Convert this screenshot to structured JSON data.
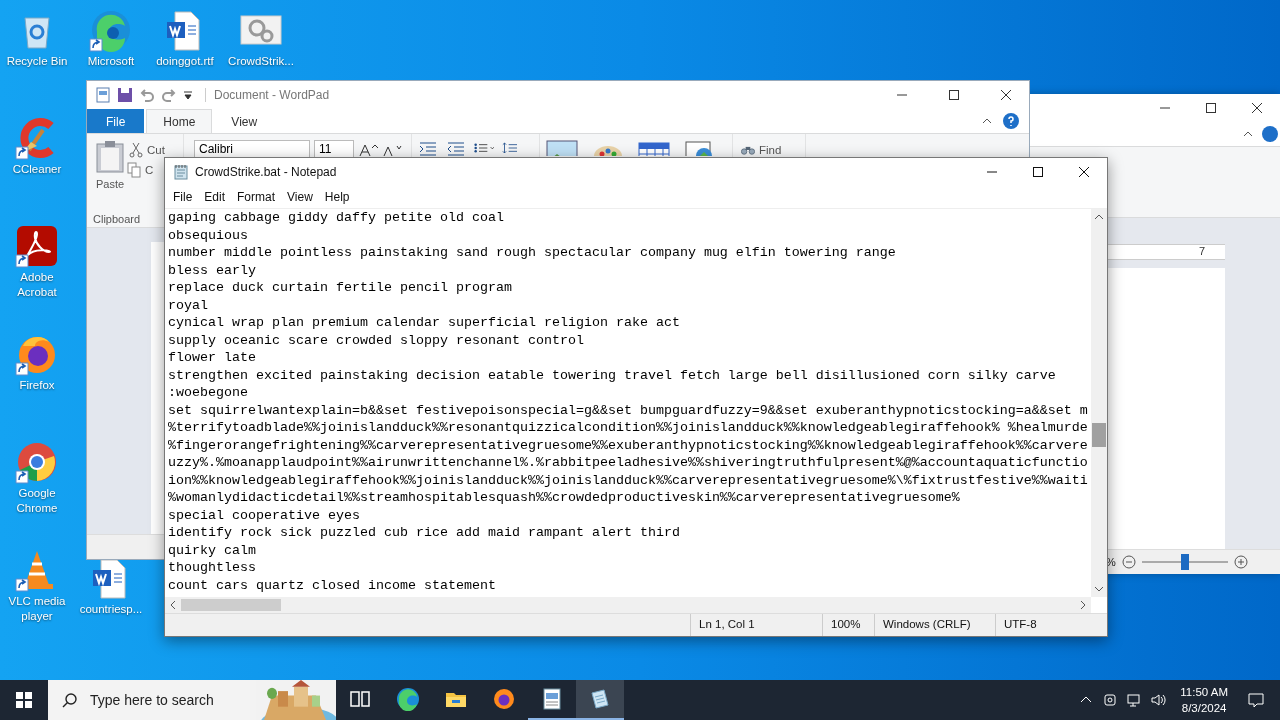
{
  "desktop": {
    "icons": [
      {
        "label": "Recycle Bin",
        "kind": "recycle",
        "shortcut": false
      },
      {
        "label": "Microsoft",
        "kind": "edge",
        "shortcut": true
      },
      {
        "label": "doinggot.rtf",
        "kind": "word",
        "shortcut": false
      },
      {
        "label": "CrowdStrik...",
        "kind": "gears",
        "shortcut": false
      },
      {
        "label": "CCleaner",
        "kind": "ccleaner",
        "shortcut": true
      },
      {
        "label": "Adobe Acrobat",
        "kind": "acrobat",
        "shortcut": true
      },
      {
        "label": "Firefox",
        "kind": "firefox",
        "shortcut": true
      },
      {
        "label": "Google Chrome",
        "kind": "chrome",
        "shortcut": true
      },
      {
        "label": "VLC media player",
        "kind": "vlc",
        "shortcut": true
      },
      {
        "label": "countriesp...",
        "kind": "word",
        "shortcut": false
      }
    ]
  },
  "back_window": {
    "ruler_mark": "7",
    "zoom": {
      "reading": "%",
      "level": 0.5
    }
  },
  "wordpad": {
    "title": "Document - WordPad",
    "tabs": [
      {
        "label": "File",
        "kind": "menu",
        "selected": false
      },
      {
        "label": "Home",
        "kind": "tab",
        "selected": true
      },
      {
        "label": "View",
        "kind": "tab",
        "selected": false
      }
    ],
    "clipboard": {
      "paste": "Paste",
      "cut": "Cut",
      "copy": "C",
      "group": "Clipboard"
    },
    "font": {
      "name": "Calibri",
      "size": "11"
    },
    "find": "Find"
  },
  "notepad": {
    "title": "CrowdStrike.bat - Notepad",
    "menu": [
      "File",
      "Edit",
      "Format",
      "View",
      "Help"
    ],
    "lines": [
      "gaping cabbage giddy daffy petite old coal",
      "obsequious",
      "number middle pointless painstaking sand rough spectacular company mug elfin towering range",
      "bless early",
      "replace duck curtain fertile pencil program",
      "royal",
      "cynical wrap plan premium calendar superficial religion rake act",
      "supply oceanic scare crowded sloppy resonant control",
      "flower late",
      "strengthen excited painstaking decision eatable towering travel fetch large bell disillusioned corn silky carve",
      ":woebegone",
      "set squirrelwantexplain=b&&set festivepoisonspecial=g&&set bumpguardfuzzy=9&&set exuberanthypnoticstocking=a&&set m",
      "%terrifytoadblade%%joinislandduck%%resonantquizzicalcondition%%joinislandduck%%knowledgeablegiraffehook% %healmurde",
      "%fingerorangefrightening%%carverepresentativegruesome%%exuberanthypnoticstocking%%knowledgeablegiraffehook%%carvere",
      "uzzy%.%moanapplaudpoint%%airunwrittenchannel%.%rabbitpeeladhesive%%shiveringtruthfulpresent%@%accountaquaticfunctio",
      "ion%%knowledgeablegiraffehook%%joinislandduck%%joinislandduck%%carverepresentativegruesome%\\%fixtrustfestive%%waiti",
      "%womanlydidacticdetail%%streamhospitablesquash%%crowdedproductiveskin%%carverepresentativegruesome%",
      "special cooperative eyes",
      "identify rock sick puzzled cub rice add maid rampant alert third",
      "quirky calm",
      "thoughtless",
      "count cars quartz closed income statement"
    ],
    "status": [
      "Ln 1, Col 1",
      "100%",
      "Windows (CRLF)",
      "UTF-8"
    ]
  },
  "taskbar": {
    "search": {
      "placeholder": "Type here to search"
    },
    "apps": [
      {
        "kind": "taskview",
        "running": false,
        "selected": false
      },
      {
        "kind": "edge",
        "running": false,
        "selected": false
      },
      {
        "kind": "explorer",
        "running": false,
        "selected": false
      },
      {
        "kind": "firefox",
        "running": false,
        "selected": false
      },
      {
        "kind": "wordpad",
        "running": true,
        "selected": false
      },
      {
        "kind": "notepad",
        "running": true,
        "selected": true
      }
    ],
    "clock": {
      "time": "11:50 AM",
      "date": "8/3/2024"
    }
  }
}
